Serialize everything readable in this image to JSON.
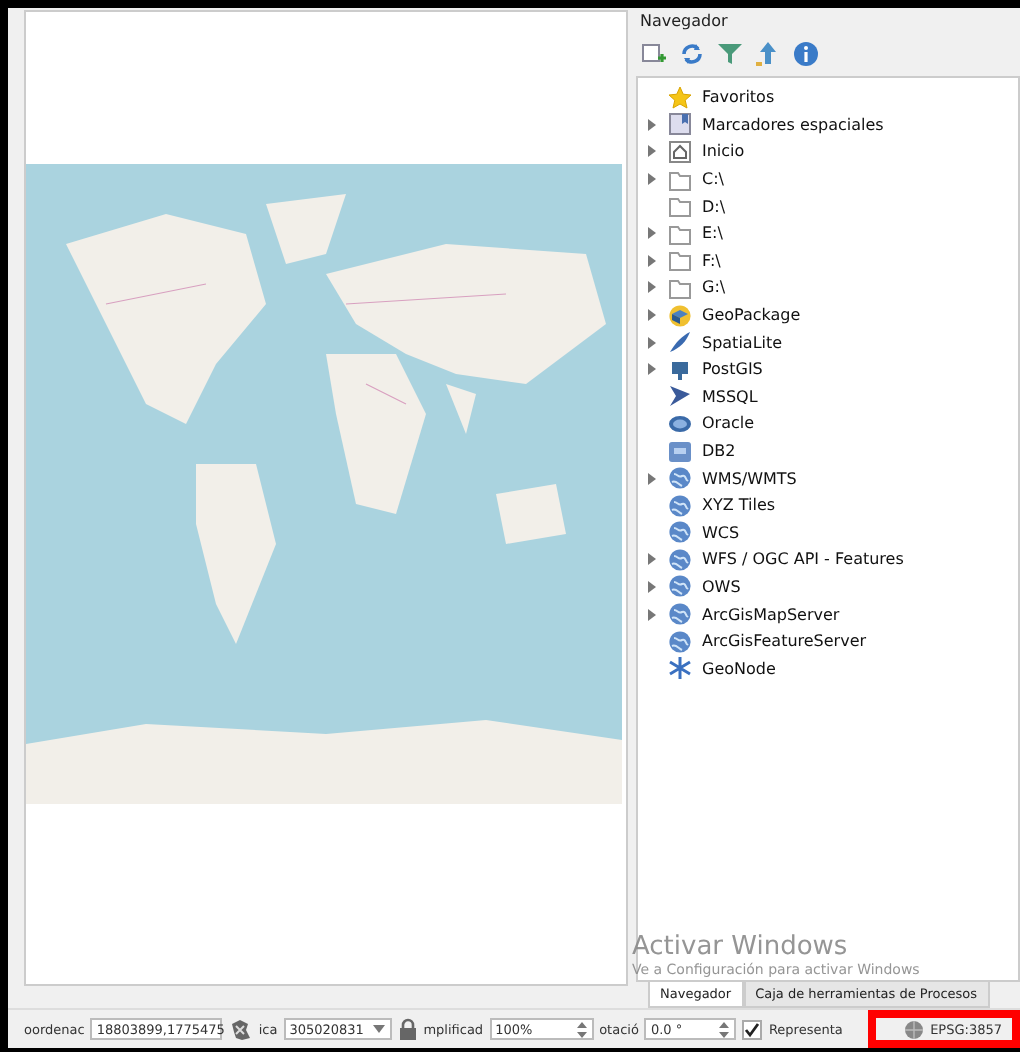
{
  "navigator": {
    "title": "Navegador",
    "tree": [
      {
        "label": "Favoritos",
        "expandable": false
      },
      {
        "label": "Marcadores espaciales",
        "expandable": true
      },
      {
        "label": "Inicio",
        "expandable": true
      },
      {
        "label": "C:\\",
        "expandable": true
      },
      {
        "label": "D:\\",
        "expandable": false
      },
      {
        "label": "E:\\",
        "expandable": true
      },
      {
        "label": "F:\\",
        "expandable": true
      },
      {
        "label": "G:\\",
        "expandable": true
      },
      {
        "label": "GeoPackage",
        "expandable": true
      },
      {
        "label": "SpatiaLite",
        "expandable": true
      },
      {
        "label": "PostGIS",
        "expandable": true
      },
      {
        "label": "MSSQL",
        "expandable": false
      },
      {
        "label": "Oracle",
        "expandable": false
      },
      {
        "label": "DB2",
        "expandable": false
      },
      {
        "label": "WMS/WMTS",
        "expandable": true
      },
      {
        "label": "XYZ Tiles",
        "expandable": false
      },
      {
        "label": "WCS",
        "expandable": false
      },
      {
        "label": "WFS / OGC API - Features",
        "expandable": true
      },
      {
        "label": "OWS",
        "expandable": true
      },
      {
        "label": "ArcGisMapServer",
        "expandable": true
      },
      {
        "label": "ArcGisFeatureServer",
        "expandable": false
      },
      {
        "label": "GeoNode",
        "expandable": false
      }
    ]
  },
  "os_notice": {
    "title": "Activar Windows",
    "text": "Ve a Configuración para activar Windows"
  },
  "dock_tabs": [
    {
      "label": "Navegador",
      "selected": true
    },
    {
      "label": "Caja de herramientas de Procesos",
      "selected": false
    }
  ],
  "status_bar": {
    "coordinate_label": "oordenac",
    "coordinate": "18803899,1775475",
    "scale_label": "ica",
    "scale": "305020831",
    "magnifier_label": "mplificad",
    "magnifier": "100%",
    "rotation_label": "otació",
    "rotation": "0.0 °",
    "render": {
      "label": "Representa",
      "checked": true
    },
    "crs": "EPSG:3857"
  }
}
